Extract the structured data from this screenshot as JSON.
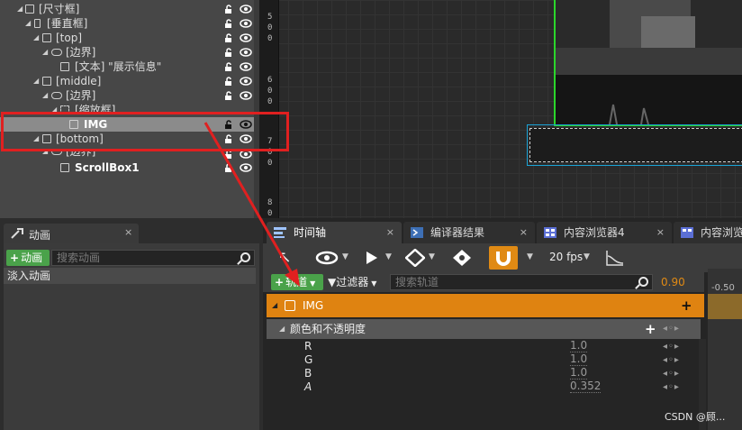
{
  "hierarchy": {
    "rows": [
      {
        "label": "[尺寸框]",
        "icon": "size-box"
      },
      {
        "label": "[垂直框]",
        "icon": "vertical-box"
      },
      {
        "label": "[top]",
        "icon": "overlay"
      },
      {
        "label": "[边界]",
        "icon": "border"
      },
      {
        "label": "[文本] \"展示信息\"",
        "icon": "text"
      },
      {
        "label": "[middle]",
        "icon": "overlay"
      },
      {
        "label": "[边界]",
        "icon": "border"
      },
      {
        "label": "[缩放框]",
        "icon": "scale-box"
      },
      {
        "label": "IMG",
        "icon": "image"
      },
      {
        "label": "[bottom]",
        "icon": "overlay"
      },
      {
        "label": "[边界]",
        "icon": "border"
      },
      {
        "label": "ScrollBox1",
        "icon": "scroll-box"
      }
    ]
  },
  "viewport": {
    "ruler_labels": [
      "5",
      "0",
      "0",
      "6",
      "0",
      "0",
      "7",
      "0",
      "0",
      "8",
      "0"
    ]
  },
  "animation_panel": {
    "tab_label": "动画",
    "close_label": "×",
    "add_button_label": "动画",
    "search_placeholder": "搜索动画",
    "animations": [
      "淡入动画"
    ]
  },
  "timeline": {
    "tabs": [
      {
        "label": "时间轴",
        "close": "×"
      },
      {
        "label": "编译器结果",
        "close": "×"
      },
      {
        "label": "内容浏览器4",
        "close": "×"
      },
      {
        "label": "内容浏览"
      }
    ],
    "fps_label": "20 fps",
    "track_button_label": "轨道",
    "filter_label": "过滤器",
    "search_placeholder": "搜索轨道",
    "current_time": "0.90",
    "curve_label": "-0.50",
    "object_track": "IMG",
    "property_track": "颜色和不透明度",
    "channels": [
      {
        "name": "R",
        "value": "1.0"
      },
      {
        "name": "G",
        "value": "1.0"
      },
      {
        "name": "B",
        "value": "1.0"
      },
      {
        "name": "A",
        "value": "0.352"
      }
    ],
    "key_controls": "◂◦▸"
  },
  "watermark": "CSDN @顾...",
  "colors": {
    "accent_orange": "#df8311",
    "green_button": "#4aa24a",
    "annotation_red": "#e02020",
    "image_outline_green": "#2bd62b",
    "scrollbox_outline_blue": "#1aa3d6"
  }
}
